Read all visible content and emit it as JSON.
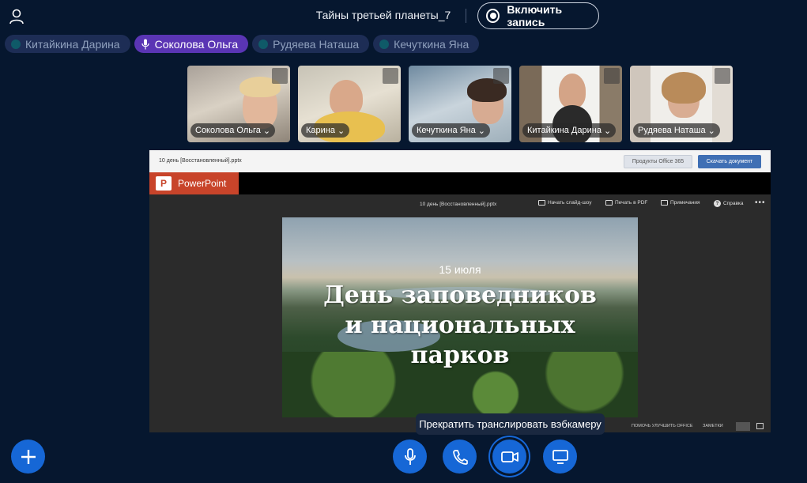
{
  "header": {
    "meeting_title": "Тайны третьей планеты_7",
    "record_label": "Включить запись"
  },
  "participants": [
    {
      "name": "Китайкина Дарина",
      "active": false
    },
    {
      "name": "Соколова Ольга",
      "active": true
    },
    {
      "name": "Рудяева Наташа",
      "active": false
    },
    {
      "name": "Кечуткина Яна",
      "active": false
    }
  ],
  "video_tiles": [
    {
      "name": "Соколова Ольга"
    },
    {
      "name": "Карина"
    },
    {
      "name": "Кечуткина Яна"
    },
    {
      "name": "Китайкина Дарина"
    },
    {
      "name": "Рудяева Наташа"
    }
  ],
  "document": {
    "filename": "10 день [Восстановленный].pptx",
    "office_products_label": "Продукты Office 365",
    "download_label": "Скачать документ",
    "app_name": "PowerPoint",
    "app_logo_letter": "P",
    "toolbar_filename": "10 день [Восстановленный].pptx",
    "toolbar": {
      "slideshow": "Начать слайд-шоу",
      "print_pdf": "Печать в PDF",
      "comments": "Примечания",
      "help": "Справка",
      "more": "•••"
    },
    "slide": {
      "date": "15 июля",
      "title_line1": "День заповедников",
      "title_line2": "и национальных",
      "title_line3": "парков"
    },
    "status": {
      "improve": "ПОМОЧЬ УЛУЧШИТЬ OFFICE",
      "notes": "ЗАМЕТКИ"
    }
  },
  "tooltip": "Прекратить транслировать вэбкамеру",
  "colors": {
    "background": "#06172f",
    "accent": "#1667d6",
    "active_chip": "#5a35b4",
    "powerpoint": "#c8442a"
  },
  "icons": {
    "user": "user-icon",
    "add": "plus-icon",
    "mic": "microphone-icon",
    "phone": "phone-icon",
    "camera": "video-camera-icon",
    "screen": "monitor-icon"
  }
}
